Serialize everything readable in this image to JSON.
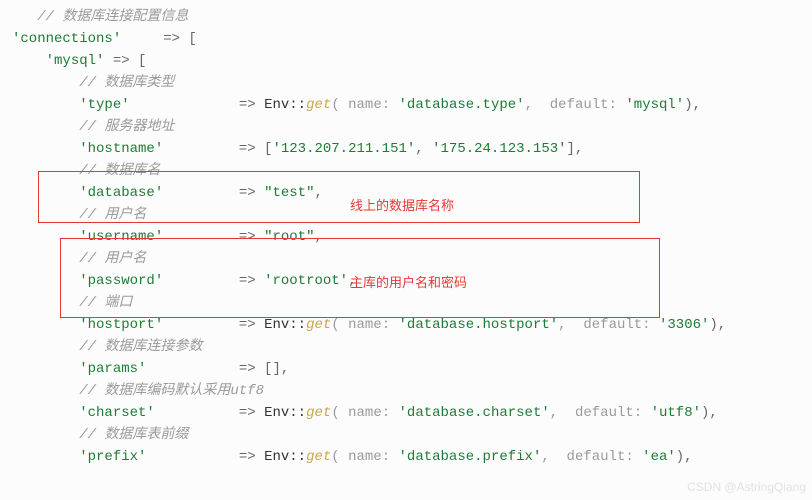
{
  "code": {
    "l1": "// 数据库连接配置信息",
    "l2a": "'connections'",
    "l2b": "     => [",
    "l3a": "'mysql'",
    "l3b": " => [",
    "l4": "// 数据库类型",
    "l5_key": "'type'",
    "l5_arrow": " => ",
    "l5_env": "Env::",
    "l5_get": "get",
    "l5_p1": "( name: ",
    "l5_v1": "'database.type'",
    "l5_p2": ",  default: ",
    "l5_v2": "'mysql'",
    "l5_close": "),",
    "l6": "// 服务器地址",
    "l7_key": "'hostname'",
    "l7_arrow": " => [",
    "l7_v1": "'123.207.211.151'",
    "l7_comma": ", ",
    "l7_v2": "'175.24.123.153'",
    "l7_close": "],",
    "l8": "// 数据库名",
    "l9_key": "'database'",
    "l9_arrow": " => ",
    "l9_val": "\"test\"",
    "l9_close": ",",
    "l10": "// 用户名",
    "l11_key": "'username'",
    "l11_arrow": " => ",
    "l11_val": "\"root\"",
    "l11_close": ",",
    "l12": "// 用户名",
    "l13_key": "'password'",
    "l13_arrow": " => ",
    "l13_val": "'rootroot'",
    "l13_close": ",",
    "l14": "// 端口",
    "l15_key": "'hostport'",
    "l15_arrow": " => ",
    "l15_env": "Env::",
    "l15_get": "get",
    "l15_p1": "( name: ",
    "l15_v1": "'database.hostport'",
    "l15_p2": ",  default: ",
    "l15_v2": "'3306'",
    "l15_close": "),",
    "l16": "// 数据库连接参数",
    "l17_key": "'params'",
    "l17_arrow": " => []",
    "l17_close": ",",
    "l18": "// 数据库编码默认采用utf8",
    "l19_key": "'charset'",
    "l19_arrow": " => ",
    "l19_env": "Env::",
    "l19_get": "get",
    "l19_p1": "( name: ",
    "l19_v1": "'database.charset'",
    "l19_p2": ",  default: ",
    "l19_v2": "'utf8'",
    "l19_close": "),",
    "l20": "// 数据库表前缀",
    "l21_key": "'prefix'",
    "l21_arrow": " => ",
    "l21_env": "Env::",
    "l21_get": "get",
    "l21_p1": "( name: ",
    "l21_v1": "'database.prefix'",
    "l21_p2": ",  default: ",
    "l21_v2": "'ea'",
    "l21_close": "),"
  },
  "annotations": {
    "red1": "线上的数据库名称",
    "red2": "主库的用户名和密码"
  },
  "watermark": "CSDN @AstringQiang"
}
